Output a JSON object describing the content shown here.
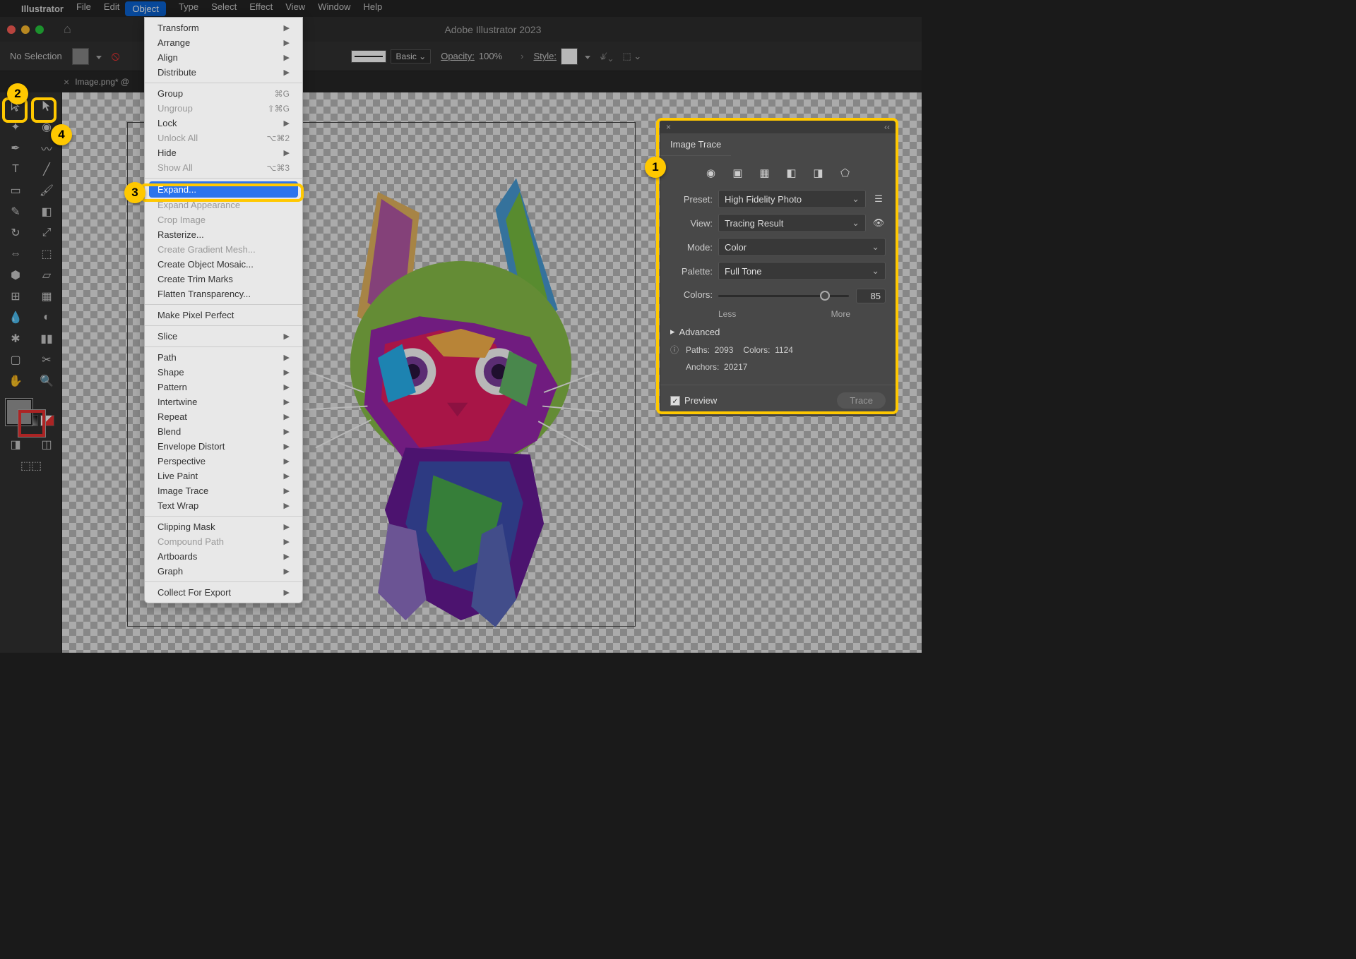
{
  "menubar": {
    "app_name": "Illustrator",
    "items": [
      "File",
      "Edit",
      "Object",
      "Type",
      "Select",
      "Effect",
      "View",
      "Window",
      "Help"
    ],
    "active_index": 2
  },
  "window": {
    "title": "Adobe Illustrator 2023"
  },
  "control_bar": {
    "selection": "No Selection",
    "stroke_style": "Basic",
    "opacity_label": "Opacity:",
    "opacity_value": "100%",
    "style_label": "Style:"
  },
  "tab": {
    "name": "Image.png* @"
  },
  "dropdown": {
    "groups": [
      [
        {
          "label": "Transform",
          "submenu": true
        },
        {
          "label": "Arrange",
          "submenu": true
        },
        {
          "label": "Align",
          "submenu": true
        },
        {
          "label": "Distribute",
          "submenu": true
        }
      ],
      [
        {
          "label": "Group",
          "shortcut": "⌘G"
        },
        {
          "label": "Ungroup",
          "shortcut": "⇧⌘G",
          "disabled": true
        },
        {
          "label": "Lock",
          "submenu": true
        },
        {
          "label": "Unlock All",
          "shortcut": "⌥⌘2",
          "disabled": true
        },
        {
          "label": "Hide",
          "submenu": true
        },
        {
          "label": "Show All",
          "shortcut": "⌥⌘3",
          "disabled": true
        }
      ],
      [
        {
          "label": "Expand...",
          "highlighted": true
        },
        {
          "label": "Expand Appearance",
          "disabled": true
        },
        {
          "label": "Crop Image",
          "disabled": true
        },
        {
          "label": "Rasterize..."
        },
        {
          "label": "Create Gradient Mesh...",
          "disabled": true
        },
        {
          "label": "Create Object Mosaic..."
        },
        {
          "label": "Create Trim Marks"
        },
        {
          "label": "Flatten Transparency..."
        }
      ],
      [
        {
          "label": "Make Pixel Perfect"
        }
      ],
      [
        {
          "label": "Slice",
          "submenu": true
        }
      ],
      [
        {
          "label": "Path",
          "submenu": true
        },
        {
          "label": "Shape",
          "submenu": true
        },
        {
          "label": "Pattern",
          "submenu": true
        },
        {
          "label": "Intertwine",
          "submenu": true
        },
        {
          "label": "Repeat",
          "submenu": true
        },
        {
          "label": "Blend",
          "submenu": true
        },
        {
          "label": "Envelope Distort",
          "submenu": true
        },
        {
          "label": "Perspective",
          "submenu": true
        },
        {
          "label": "Live Paint",
          "submenu": true
        },
        {
          "label": "Image Trace",
          "submenu": true
        },
        {
          "label": "Text Wrap",
          "submenu": true
        }
      ],
      [
        {
          "label": "Clipping Mask",
          "submenu": true
        },
        {
          "label": "Compound Path",
          "submenu": true,
          "disabled": true
        },
        {
          "label": "Artboards",
          "submenu": true
        },
        {
          "label": "Graph",
          "submenu": true
        }
      ],
      [
        {
          "label": "Collect For Export",
          "submenu": true
        }
      ]
    ]
  },
  "image_trace": {
    "title": "Image Trace",
    "preset_label": "Preset:",
    "preset_value": "High Fidelity Photo",
    "view_label": "View:",
    "view_value": "Tracing Result",
    "mode_label": "Mode:",
    "mode_value": "Color",
    "palette_label": "Palette:",
    "palette_value": "Full Tone",
    "colors_label": "Colors:",
    "colors_value": "85",
    "less": "Less",
    "more": "More",
    "advanced": "Advanced",
    "paths_label": "Paths:",
    "paths_value": "2093",
    "colors_stat_label": "Colors:",
    "colors_stat_value": "1124",
    "anchors_label": "Anchors:",
    "anchors_value": "20217",
    "preview": "Preview",
    "trace": "Trace"
  },
  "callouts": {
    "c1": "1",
    "c2": "2",
    "c3": "3",
    "c4": "4"
  }
}
